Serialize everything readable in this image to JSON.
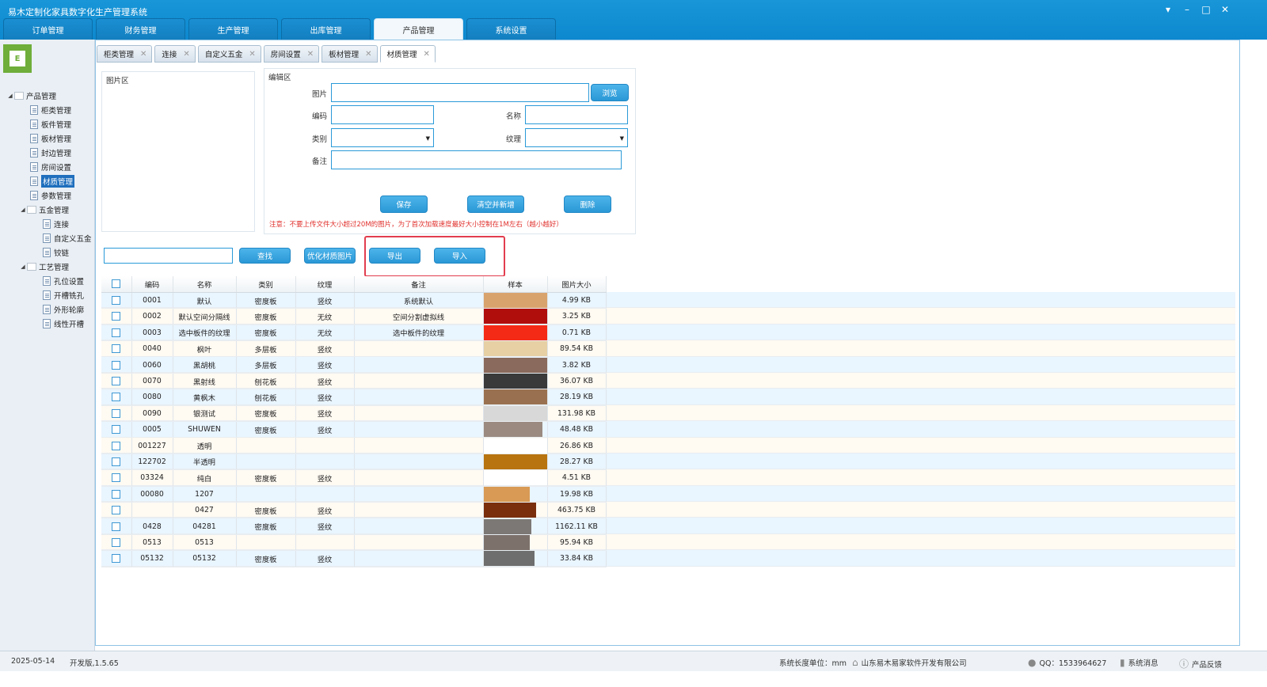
{
  "app": {
    "title": "易木定制化家具数字化生产管理系统"
  },
  "main_tabs": [
    {
      "label": "订单管理"
    },
    {
      "label": "财务管理"
    },
    {
      "label": "生产管理"
    },
    {
      "label": "出库管理"
    },
    {
      "label": "产品管理"
    },
    {
      "label": "系统设置"
    }
  ],
  "sidebar": {
    "tree": [
      {
        "label": "产品管理"
      },
      {
        "label": "柜类管理"
      },
      {
        "label": "板件管理"
      },
      {
        "label": "板材管理"
      },
      {
        "label": "封边管理"
      },
      {
        "label": "房间设置"
      },
      {
        "label": "材质管理"
      },
      {
        "label": "参数管理"
      },
      {
        "label": "五金管理"
      },
      {
        "label": "连接"
      },
      {
        "label": "自定义五金"
      },
      {
        "label": "铰链"
      },
      {
        "label": "工艺管理"
      },
      {
        "label": "孔位设置"
      },
      {
        "label": "开槽铣孔"
      },
      {
        "label": "外形轮廓"
      },
      {
        "label": "线性开槽"
      }
    ]
  },
  "sub_tabs": [
    {
      "label": "柜类管理"
    },
    {
      "label": "连接"
    },
    {
      "label": "自定义五金"
    },
    {
      "label": "房间设置"
    },
    {
      "label": "板材管理"
    },
    {
      "label": "材质管理"
    }
  ],
  "pic_area": {
    "label": "图片区"
  },
  "edit_area": {
    "label": "编辑区",
    "image_label": "图片",
    "browse": "浏览",
    "code_label": "编码",
    "name_label": "名称",
    "category_label": "类别",
    "texture_label": "纹理",
    "remark_label": "备注",
    "save": "保存",
    "clear_new": "清空并新增",
    "delete": "删除",
    "notice": "注意：不要上传文件大小超过20M的图片，为了首次加载速度最好大小控制在1M左右（越小越好）"
  },
  "toolbar": {
    "search_value": "",
    "find": "查找",
    "optimize": "优化材质图片",
    "export": "导出",
    "import": "导入"
  },
  "table": {
    "columns": [
      "编码",
      "名称",
      "类别",
      "纹理",
      "备注",
      "样本",
      "图片大小"
    ],
    "rows": [
      {
        "code": "0001",
        "name": "默认",
        "category": "密度板",
        "texture": "竖纹",
        "remark": "系统默认",
        "sample_color": "#d9a36e",
        "sample_width": 80,
        "size": "4.99 KB"
      },
      {
        "code": "0002",
        "name": "默认空间分隔线",
        "category": "密度板",
        "texture": "无纹",
        "remark": "空间分割虚拟线",
        "sample_color": "#b00d0d",
        "sample_width": 80,
        "size": "3.25 KB"
      },
      {
        "code": "0003",
        "name": "选中板件的纹理",
        "category": "密度板",
        "texture": "无纹",
        "remark": "选中板件的纹理",
        "sample_color": "#f52a16",
        "sample_width": 80,
        "size": "0.71 KB"
      },
      {
        "code": "0040",
        "name": "枫叶",
        "category": "多层板",
        "texture": "竖纹",
        "remark": "",
        "sample_color": "#e6d0a4",
        "sample_width": 80,
        "size": "89.54 KB"
      },
      {
        "code": "0060",
        "name": "黑胡桃",
        "category": "多层板",
        "texture": "竖纹",
        "remark": "",
        "sample_color": "#8a6a5c",
        "sample_width": 80,
        "size": "3.82 KB"
      },
      {
        "code": "0070",
        "name": "黑射线",
        "category": "刨花板",
        "texture": "竖纹",
        "remark": "",
        "sample_color": "#3a3a3a",
        "sample_width": 80,
        "size": "36.07 KB"
      },
      {
        "code": "0080",
        "name": "黄枫木",
        "category": "刨花板",
        "texture": "竖纹",
        "remark": "",
        "sample_color": "#9a7150",
        "sample_width": 80,
        "size": "28.19 KB"
      },
      {
        "code": "0090",
        "name": "银测试",
        "category": "密度板",
        "texture": "竖纹",
        "remark": "",
        "sample_color": "#d8d8d8",
        "sample_width": 80,
        "size": "131.98 KB"
      },
      {
        "code": "0005",
        "name": "SHUWEN",
        "category": "密度板",
        "texture": "竖纹",
        "remark": "",
        "sample_color": "#9a8a80",
        "sample_width": 74,
        "size": "48.48 KB"
      },
      {
        "code": "001227",
        "name": "透明",
        "category": "",
        "texture": "",
        "remark": "",
        "sample_color": "#ffffff",
        "sample_width": 80,
        "size": "26.86 KB"
      },
      {
        "code": "122702",
        "name": "半透明",
        "category": "",
        "texture": "",
        "remark": "",
        "sample_color": "#b8740f",
        "sample_width": 80,
        "size": "28.27 KB"
      },
      {
        "code": "03324",
        "name": "纯白",
        "category": "密度板",
        "texture": "竖纹",
        "remark": "",
        "sample_color": "#ffffff",
        "sample_width": 80,
        "size": "4.51 KB"
      },
      {
        "code": "00080",
        "name": "1207",
        "category": "",
        "texture": "",
        "remark": "",
        "sample_color": "#d89a55",
        "sample_width": 58,
        "size": "19.98 KB"
      },
      {
        "code": "",
        "name": "0427",
        "category": "密度板",
        "texture": "竖纹",
        "remark": "",
        "sample_color": "#7a2e0c",
        "sample_width": 66,
        "size": "463.75 KB"
      },
      {
        "code": "0428",
        "name": "04281",
        "category": "密度板",
        "texture": "竖纹",
        "remark": "",
        "sample_color": "#7c7875",
        "sample_width": 60,
        "size": "1162.11 KB"
      },
      {
        "code": "0513",
        "name": "0513",
        "category": "",
        "texture": "",
        "remark": "",
        "sample_color": "#7d716c",
        "sample_width": 58,
        "size": "95.94 KB"
      },
      {
        "code": "05132",
        "name": "05132",
        "category": "密度板",
        "texture": "竖纹",
        "remark": "",
        "sample_color": "#6e6e6e",
        "sample_width": 64,
        "size": "33.84 KB"
      }
    ]
  },
  "status": {
    "date": "2025-05-14",
    "version": "开发版,1.5.65",
    "unit": "系统长度单位：mm",
    "company": "山东易木易家软件开发有限公司",
    "qq": "QQ：1533964627",
    "messages": "系统消息",
    "feedback": "产品反馈"
  },
  "colors": {
    "titlebar": "#1896d8",
    "accent": "#2a98d6",
    "highlight": "#e23d4e",
    "notice": "#e0312d"
  }
}
